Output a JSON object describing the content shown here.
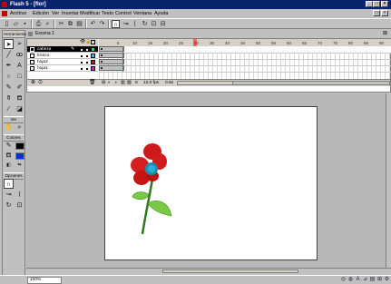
{
  "window": {
    "title": "Flash 5 - [flor]"
  },
  "menu": [
    "Archivo",
    "Edición",
    "Ver",
    "Insertar",
    "Modificar",
    "Texto",
    "Control",
    "Ventana",
    "Ayuda"
  ],
  "toolbar": {
    "icons": [
      "new-icon",
      "open-icon",
      "save-icon",
      "print-icon",
      "print-preview-icon",
      "cut-icon",
      "copy-icon",
      "paste-icon",
      "undo-icon",
      "redo-icon",
      "snap-icon",
      "smooth-icon",
      "straighten-icon",
      "rotate-icon",
      "scale-icon",
      "align-icon"
    ]
  },
  "tools_panel": {
    "title": "Herramientas",
    "sections": {
      "view": "Ver",
      "colors": "Colores",
      "options": "Opciones"
    }
  },
  "scene": {
    "label": "Escena 1"
  },
  "timeline": {
    "ruler_ticks": [
      "5",
      "10",
      "15",
      "20",
      "25",
      "30",
      "35",
      "40",
      "45",
      "50",
      "55",
      "60",
      "65",
      "70",
      "75",
      "80",
      "85",
      "90"
    ],
    "layers": [
      {
        "name": "cabeza",
        "active": true,
        "color": "#00ff00"
      },
      {
        "name": "tronco",
        "active": false,
        "color": "#00ccff"
      },
      {
        "name": "hoja2",
        "active": false,
        "color": "#ff0000"
      },
      {
        "name": "hoja1",
        "active": false,
        "color": "#ff00ff"
      }
    ],
    "footer": {
      "frame": "8",
      "fps": "12.0 fps",
      "time": "0.6s"
    }
  },
  "status": {
    "zoom": "100%"
  },
  "colors": {
    "petal": "#cc1a1a",
    "center": "#1a8fb0",
    "stem": "#2f7a1f",
    "leaf": "#7ac943"
  }
}
